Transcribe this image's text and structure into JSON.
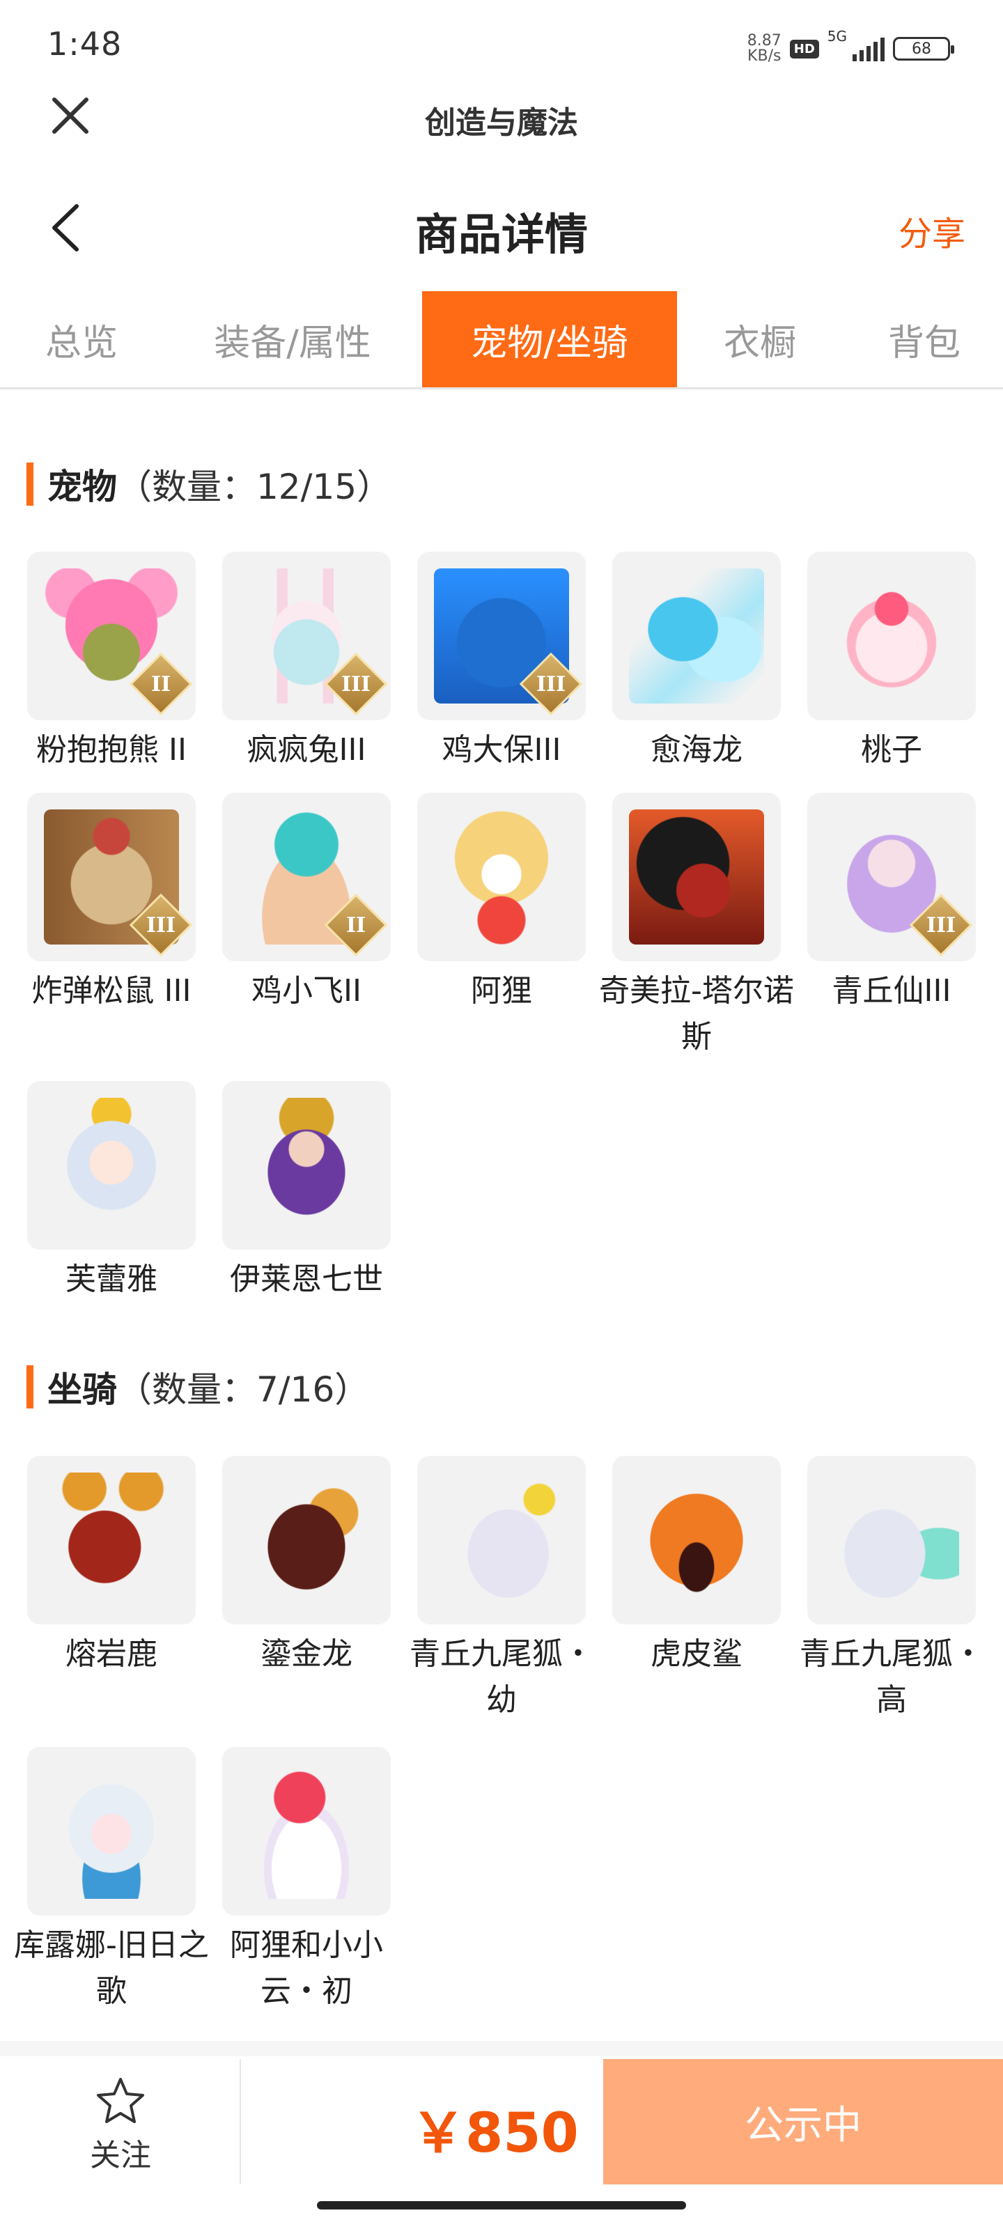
{
  "status_bar": {
    "time": "1:48",
    "net_speed": "8.87",
    "net_unit": "KB/s",
    "hd": "HD",
    "network": "5G",
    "battery": "68"
  },
  "header": {
    "app_title": "创造与魔法",
    "page_title": "商品详情",
    "share": "分享"
  },
  "tabs": [
    {
      "label": "总览",
      "active": false
    },
    {
      "label": "装备/属性",
      "active": false
    },
    {
      "label": "宠物/坐骑",
      "active": true
    },
    {
      "label": "衣橱",
      "active": false
    },
    {
      "label": "背包",
      "active": false
    }
  ],
  "pets": {
    "title": "宠物",
    "count": "（数量：12/15）",
    "items": [
      {
        "name": "粉抱抱熊 II",
        "badge": "II"
      },
      {
        "name": "疯疯兔III",
        "badge": "III"
      },
      {
        "name": "鸡大保III",
        "badge": "III"
      },
      {
        "name": "愈海龙",
        "badge": ""
      },
      {
        "name": "桃子",
        "badge": ""
      },
      {
        "name": "炸弹松鼠 III",
        "badge": "III"
      },
      {
        "name": "鸡小飞II",
        "badge": "II"
      },
      {
        "name": "阿狸",
        "badge": ""
      },
      {
        "name": "奇美拉-塔尔诺斯",
        "badge": ""
      },
      {
        "name": "青丘仙III",
        "badge": "III"
      },
      {
        "name": "芙蕾雅",
        "badge": ""
      },
      {
        "name": "伊莱恩七世",
        "badge": ""
      }
    ]
  },
  "mounts": {
    "title": "坐骑",
    "count": "（数量：7/16）",
    "items": [
      {
        "name": "熔岩鹿"
      },
      {
        "name": "鎏金龙"
      },
      {
        "name": "青丘九尾狐・幼"
      },
      {
        "name": "虎皮鲨"
      },
      {
        "name": "青丘九尾狐・高"
      },
      {
        "name": "库露娜-旧日之歌"
      },
      {
        "name": "阿狸和小小云・初"
      }
    ]
  },
  "bottom_bar": {
    "follow": "关注",
    "price": "￥850",
    "status_button": "公示中"
  }
}
